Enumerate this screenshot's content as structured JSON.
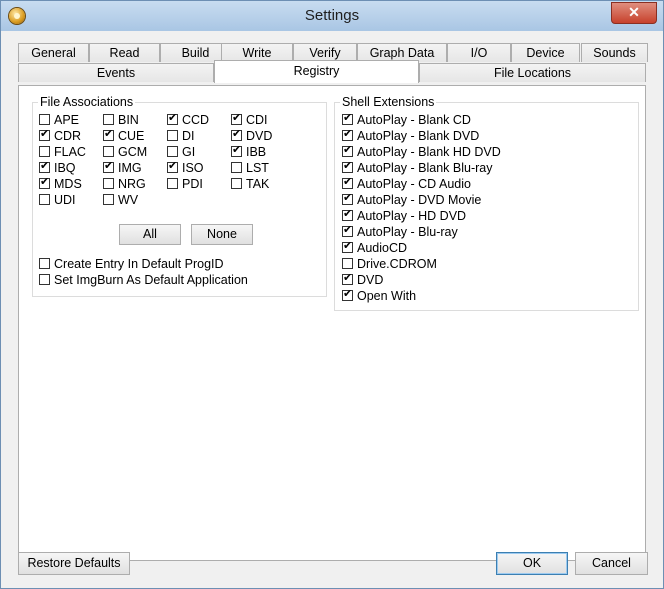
{
  "window": {
    "title": "Settings",
    "close_glyph": "✕"
  },
  "tabs_row1": [
    "General",
    "Read",
    "Build",
    "Write",
    "Verify",
    "Graph Data",
    "I/O",
    "Device",
    "Sounds"
  ],
  "tabs_row2": [
    "Events",
    "Registry",
    "File Locations"
  ],
  "active_tab": "Registry",
  "file_associations": {
    "title": "File Associations",
    "items": [
      {
        "label": "APE",
        "checked": false
      },
      {
        "label": "BIN",
        "checked": false
      },
      {
        "label": "CCD",
        "checked": true
      },
      {
        "label": "CDI",
        "checked": true
      },
      {
        "label": "CDR",
        "checked": true
      },
      {
        "label": "CUE",
        "checked": true
      },
      {
        "label": "DI",
        "checked": false
      },
      {
        "label": "DVD",
        "checked": true
      },
      {
        "label": "FLAC",
        "checked": false
      },
      {
        "label": "GCM",
        "checked": false
      },
      {
        "label": "GI",
        "checked": false
      },
      {
        "label": "IBB",
        "checked": true
      },
      {
        "label": "IBQ",
        "checked": true
      },
      {
        "label": "IMG",
        "checked": true
      },
      {
        "label": "ISO",
        "checked": true
      },
      {
        "label": "LST",
        "checked": false
      },
      {
        "label": "MDS",
        "checked": true
      },
      {
        "label": "NRG",
        "checked": false
      },
      {
        "label": "PDI",
        "checked": false
      },
      {
        "label": "TAK",
        "checked": false
      },
      {
        "label": "UDI",
        "checked": false
      },
      {
        "label": "WV",
        "checked": false
      }
    ],
    "all_label": "All",
    "none_label": "None",
    "options": [
      {
        "label": "Create Entry In Default ProgID",
        "checked": false
      },
      {
        "label": "Set ImgBurn As Default Application",
        "checked": false
      }
    ]
  },
  "shell_extensions": {
    "title": "Shell Extensions",
    "items": [
      {
        "label": "AutoPlay - Blank CD",
        "checked": true
      },
      {
        "label": "AutoPlay - Blank DVD",
        "checked": true
      },
      {
        "label": "AutoPlay - Blank HD DVD",
        "checked": true
      },
      {
        "label": "AutoPlay - Blank Blu-ray",
        "checked": true
      },
      {
        "label": "AutoPlay - CD Audio",
        "checked": true
      },
      {
        "label": "AutoPlay - DVD Movie",
        "checked": true
      },
      {
        "label": "AutoPlay - HD DVD",
        "checked": true
      },
      {
        "label": "AutoPlay - Blu-ray",
        "checked": true
      },
      {
        "label": "AudioCD",
        "checked": true
      },
      {
        "label": "Drive.CDROM",
        "checked": false
      },
      {
        "label": "DVD",
        "checked": true
      },
      {
        "label": "Open With",
        "checked": true
      }
    ]
  },
  "footer": {
    "restore_label": "Restore Defaults",
    "ok_label": "OK",
    "cancel_label": "Cancel"
  }
}
